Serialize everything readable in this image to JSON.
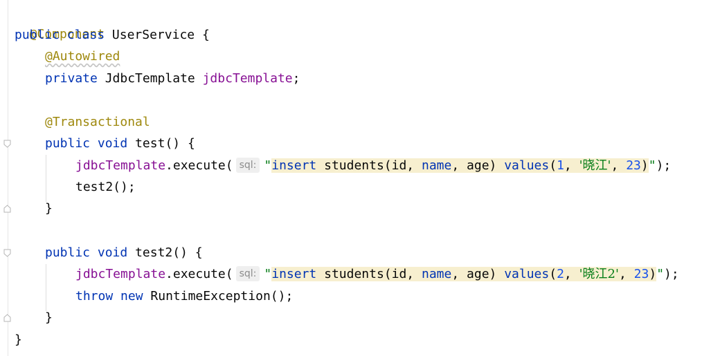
{
  "code": {
    "annotation_component": "@Component",
    "kw_public": "public",
    "kw_class": "class",
    "class_name": "UserService",
    "brace_open": "{",
    "brace_close": "}",
    "annotation_autowired": "@Autowired",
    "kw_private": "private",
    "type_jdbc": "JdbcTemplate",
    "field_jdbc": "jdbcTemplate",
    "semicolon": ";",
    "annotation_transactional": "@Transactional",
    "kw_void": "void",
    "method_test": "test",
    "method_test2": "test2",
    "parens_brace": "() {",
    "execute_call": ".execute(",
    "hint_sql": "sql:",
    "quote": "\"",
    "sql_insert": "insert",
    "sql_table": " students(id, ",
    "sql_name": "name",
    "sql_age": ", age) ",
    "sql_values": "values",
    "paren_open": "(",
    "num_1": "1",
    "num_2": "2",
    "num_23": "23",
    "comma_sp": ", ",
    "str_xj": "'晓江'",
    "str_xj2": "'晓江2'",
    "paren_close": ")",
    "close_call": ");",
    "call_test2": "test2();",
    "kw_throw": "throw",
    "kw_new": "new",
    "runtime_exc": "RuntimeException();"
  },
  "icons": {
    "fold_marker": "fold-marker-icon"
  }
}
